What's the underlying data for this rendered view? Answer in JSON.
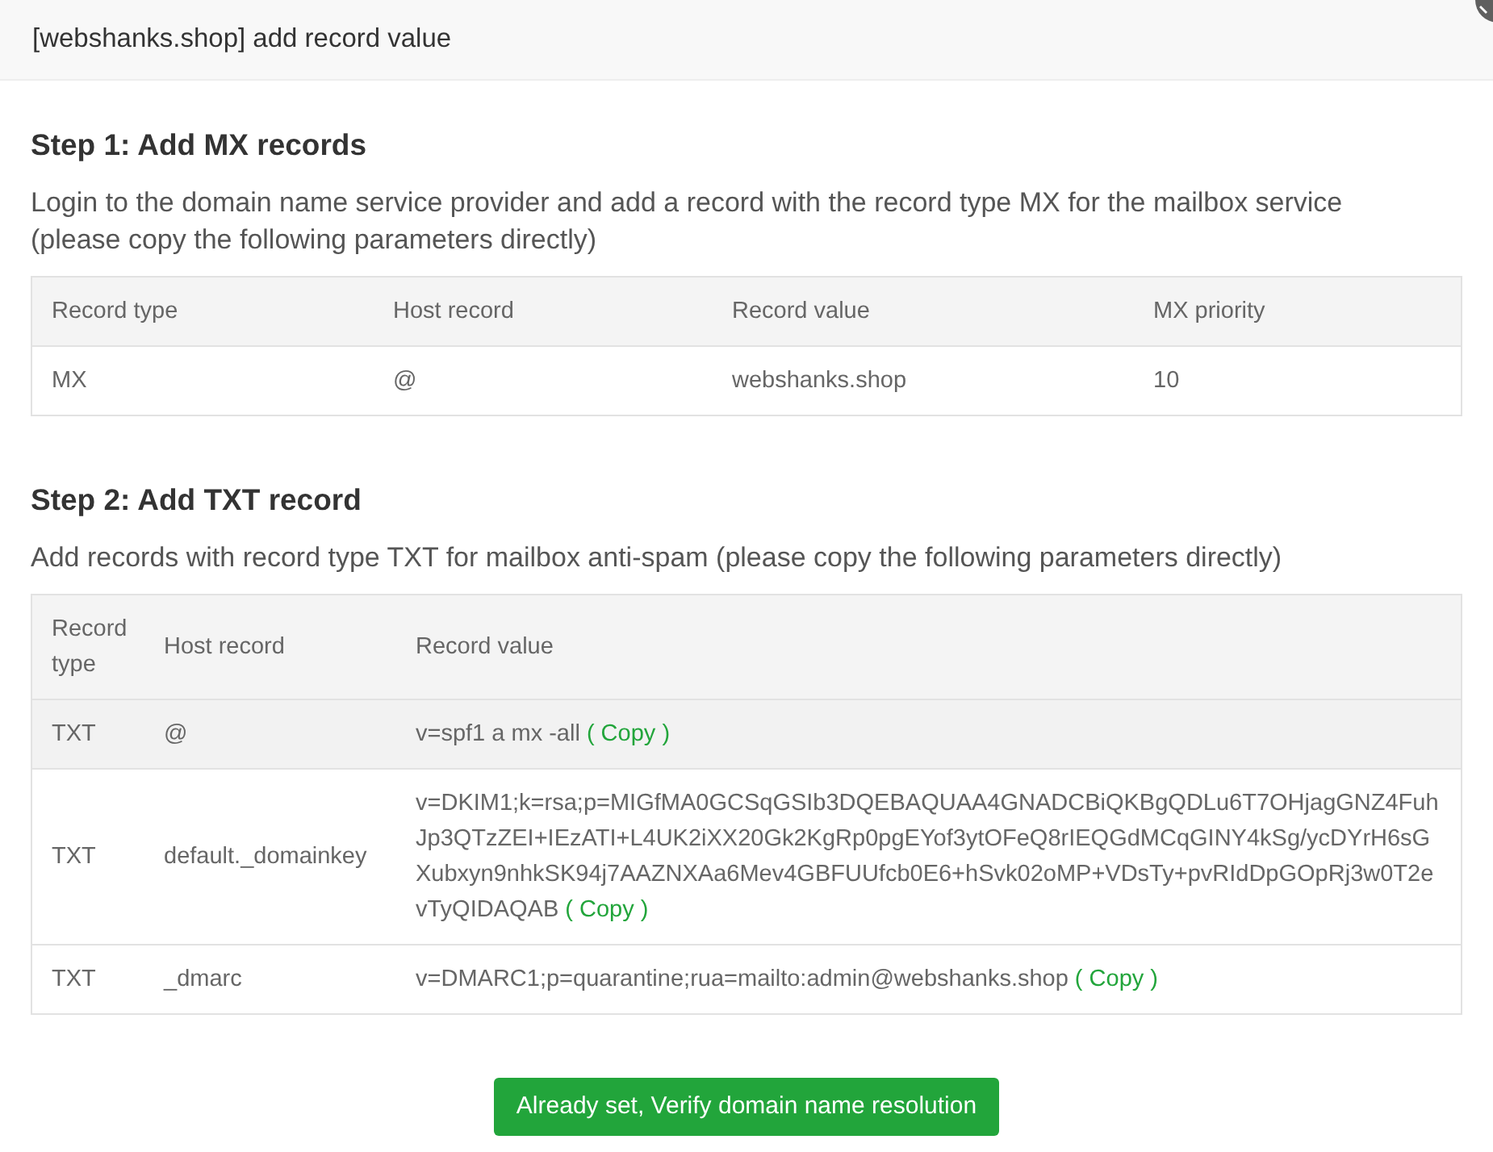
{
  "dialog": {
    "title": "[webshanks.shop] add record value"
  },
  "steps": [
    {
      "heading": "Step 1: Add MX records",
      "description": "Login to the domain name service provider and add a record with the record type MX for the mailbox service (please copy the following parameters directly)",
      "table": {
        "columns": [
          "Record type",
          "Host record",
          "Record value",
          "MX priority"
        ],
        "rows": [
          {
            "cells": [
              "MX",
              "@",
              "webshanks.shop",
              "10"
            ],
            "highlighted": false
          }
        ]
      }
    },
    {
      "heading": "Step 2: Add TXT record",
      "description": "Add records with record type TXT for mailbox anti-spam (please copy the following parameters directly)",
      "table": {
        "columns": [
          "Record type",
          "Host record",
          "Record value"
        ],
        "rows": [
          {
            "cells": [
              "TXT",
              "@",
              "v=spf1 a mx -all"
            ],
            "copy_link": "( Copy )",
            "highlighted": true
          },
          {
            "cells": [
              "TXT",
              "default._domainkey",
              "v=DKIM1;k=rsa;p=MIGfMA0GCSqGSIb3DQEBAQUAA4GNADCBiQKBgQDLu6T7OHjagGNZ4FuhJp3QTzZEI+IEzATI+L4UK2iXX20Gk2KgRp0pgEYof3ytOFeQ8rIEQGdMCqGINY4kSg/ycDYrH6sGXubxyn9nhkSK94j7AAZNXAa6Mev4GBFUUfcb0E6+hSvk02oMP+VDsTy+pvRIdDpGOpRj3w0T2evTyQIDAQAB"
            ],
            "copy_link": "( Copy )",
            "highlighted": false
          },
          {
            "cells": [
              "TXT",
              "_dmarc",
              "v=DMARC1;p=quarantine;rua=mailto:admin@webshanks.shop"
            ],
            "copy_link": "( Copy )",
            "highlighted": false
          }
        ]
      }
    }
  ],
  "button": {
    "label": "Already set, Verify domain name resolution"
  }
}
